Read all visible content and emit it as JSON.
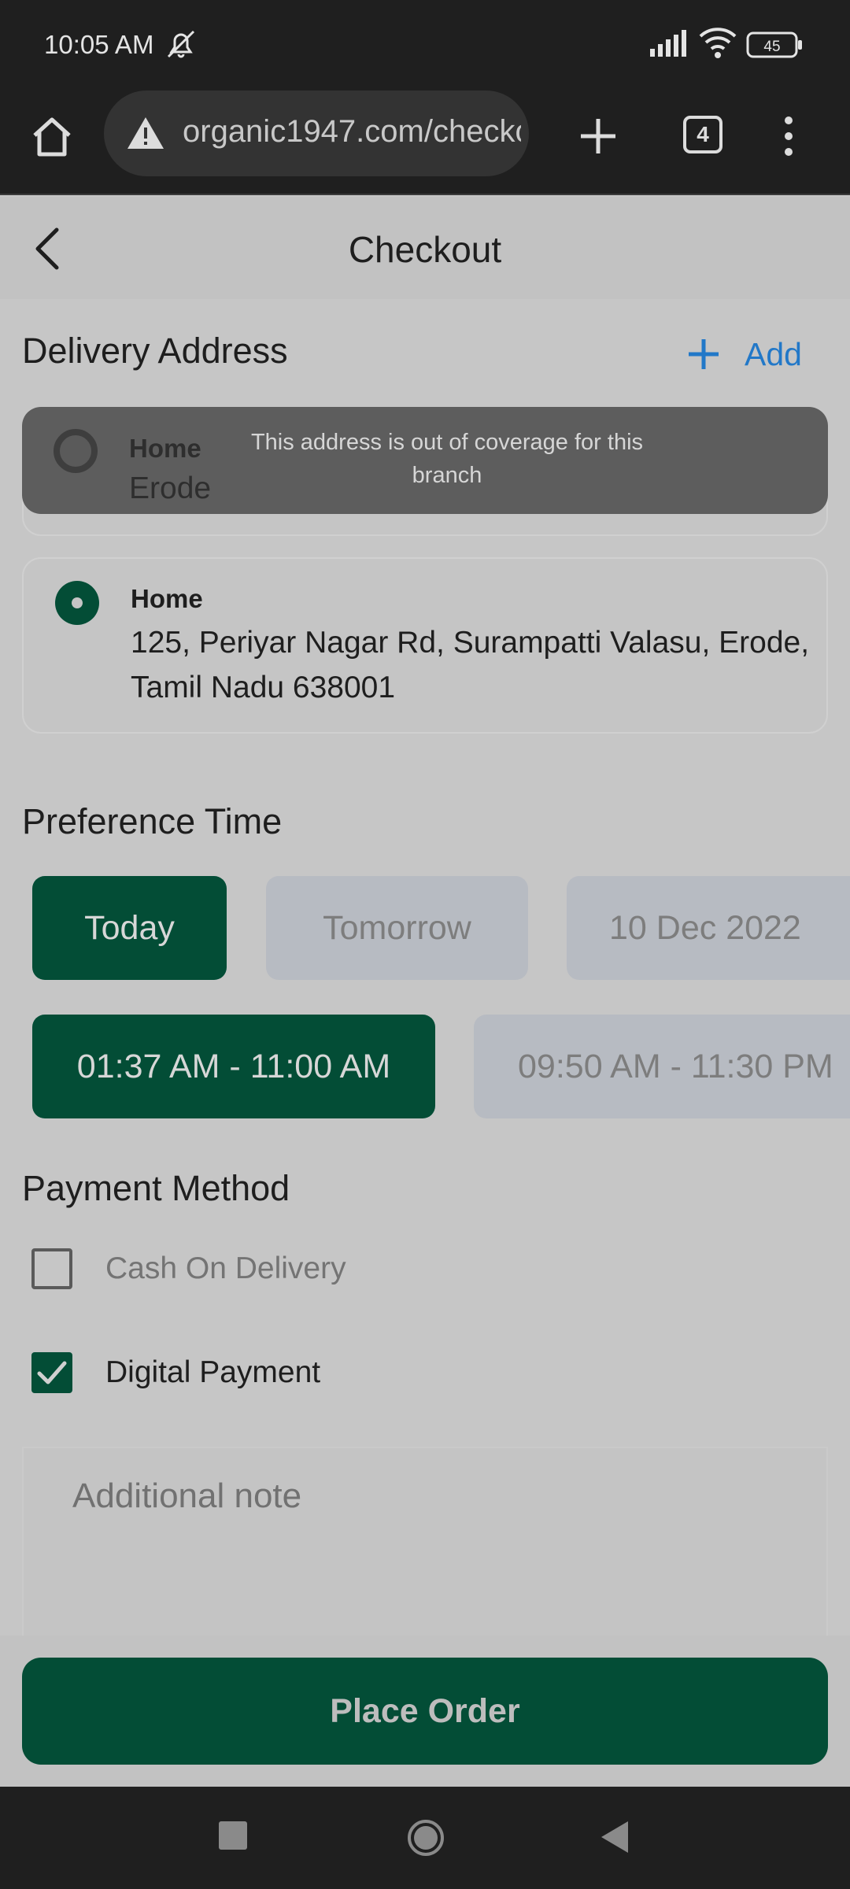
{
  "status_bar": {
    "time": "10:05 AM",
    "battery": "45",
    "icons": [
      "mute-icon",
      "signal-icon",
      "wifi-icon",
      "battery-icon"
    ]
  },
  "browser": {
    "url": "organic1947.com/checkout",
    "tab_count": "4",
    "icons": [
      "home-icon",
      "warning-icon",
      "plus-icon",
      "tabs-icon",
      "more-vert-icon"
    ]
  },
  "header": {
    "title": "Checkout"
  },
  "delivery": {
    "title": "Delivery Address",
    "add_label": "Add",
    "toast": "This address is out of coverage for this branch",
    "addresses": [
      {
        "label": "Home",
        "text": "Erode",
        "selected": false
      },
      {
        "label": "Home",
        "text": "125, Periyar Nagar Rd, Surampatti Valasu, Erode, Tamil Nadu 638001",
        "selected": true
      }
    ]
  },
  "preference": {
    "title": "Preference Time",
    "days": [
      {
        "label": "Today",
        "selected": true
      },
      {
        "label": "Tomorrow",
        "selected": false
      },
      {
        "label": "10 Dec 2022",
        "selected": false
      }
    ],
    "slots": [
      {
        "label": "01:37 AM - 11:00 AM",
        "selected": true
      },
      {
        "label": "09:50 AM - 11:30 PM",
        "selected": false
      }
    ]
  },
  "payment": {
    "title": "Payment Method",
    "options": [
      {
        "label": "Cash On Delivery",
        "checked": false
      },
      {
        "label": "Digital Payment",
        "checked": true
      }
    ]
  },
  "note": {
    "placeholder": "Additional note"
  },
  "place_order_label": "Place Order",
  "colors": {
    "accent": "#034d36",
    "link": "#2278c8",
    "overlay_bg": "#c6c6c6"
  }
}
